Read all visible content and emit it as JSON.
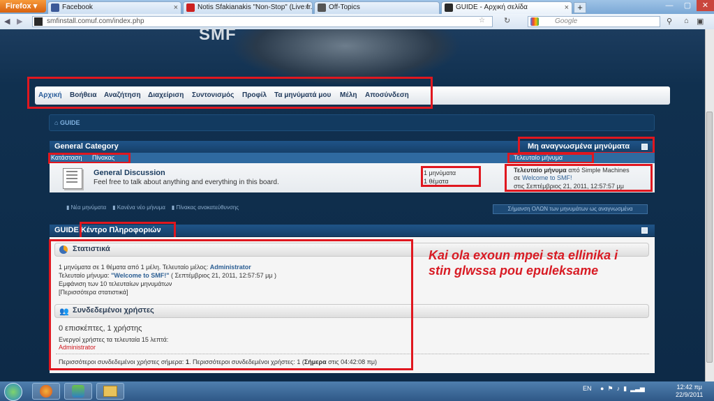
{
  "browser": {
    "menu_button": "Firefox",
    "tabs": [
      {
        "label": "Facebook",
        "fav_color": "#3b5998"
      },
      {
        "label": "Notis Sfakianakis \"Non-Stop\" (Live fr...",
        "fav_color": "#cc2020"
      },
      {
        "label": "Off-Topics",
        "fav_color": "#555555"
      },
      {
        "label": "GUIDE - Αρχική σελίδα",
        "fav_color": "#2a2a2a"
      }
    ],
    "new_tab": "+",
    "url": "smfinstall.comuf.com/index.php",
    "search_placeholder": "Google"
  },
  "site": {
    "logo": "SMF",
    "menu": [
      "Αρχική",
      "Βοήθεια",
      "Αναζήτηση",
      "Διαχείριση",
      "Συντονισμός",
      "Προφίλ",
      "Τα μηνύματά μου",
      "Μέλη",
      "Αποσύνδεση"
    ],
    "breadcrumb": "GUIDE",
    "category": {
      "title": "General Category",
      "unread": "Μη αναγνωσμένα μηνύματα",
      "col_status": "Κατάσταση",
      "col_board": "Πίνακας",
      "col_last": "Τελευταίο μήνυμα"
    },
    "board": {
      "name": "General Discussion",
      "desc": "Feel free to talk about anything and everything in this board.",
      "posts": "1 μηνύματα",
      "topics": "1 θέματα",
      "last_label": "Τελευταίο μήνυμα",
      "last_by": "από Simple Machines",
      "last_in": "σε",
      "last_topic": "Welcome to SMF!",
      "last_date": "στις Σεπτέμβριος 21, 2011, 12:57:57 μμ"
    },
    "legend": {
      "new": "Νέα μηνύματα",
      "none": "Κανένα νέο μήνυμα",
      "redirect": "Πίνακας ανακατεύθυνσης"
    },
    "mark_read": "Σήμανση ΟΛΩΝ των μηνυμάτων ως αναγνωσμένα",
    "info": {
      "title_prefix": "GUIDE",
      "title": "Κέντρο Πληροφοριών",
      "stats_title": "Στατιστικά",
      "stats_line1a": "1 μηνύματα σε 1 θέματα από 1 μέλη. Τελευταίο μέλος:",
      "stats_member": "Administrator",
      "stats_line2a": "Τελευταίο μήνυμα:",
      "stats_post": "\"Welcome to SMF!\"",
      "stats_line2b": "( Σεπτέμβριος 21, 2011, 12:57:57 μμ )",
      "stats_recent": "Εμφάνιση των 10 τελευταίων μηνυμάτων",
      "stats_more": "[Περισσότερα στατιστικά]",
      "online_title": "Συνδεδεμένοι χρήστες",
      "online_count": "0 επισκέπτες, 1 χρήστης",
      "online_active": "Ενεργοί χρήστες τα τελευταία 15 λεπτά:",
      "online_user": "Administrator",
      "footer_a": "Περισσότεροι συνδεδεμένοι χρήστες σήμερα:",
      "footer_b": "1",
      "footer_c": ". Περισσότεροι συνδεδεμένοι χρήστες: 1 (",
      "footer_d": "Σήμερα",
      "footer_e": "στις 04:42:08 πμ)"
    },
    "annotation": "Kai ola exoun mpei sta ellinika i stin glwssa pou epuleksame"
  },
  "taskbar": {
    "lang": "EN",
    "time": "12:42 πμ",
    "date": "22/9/2011"
  }
}
